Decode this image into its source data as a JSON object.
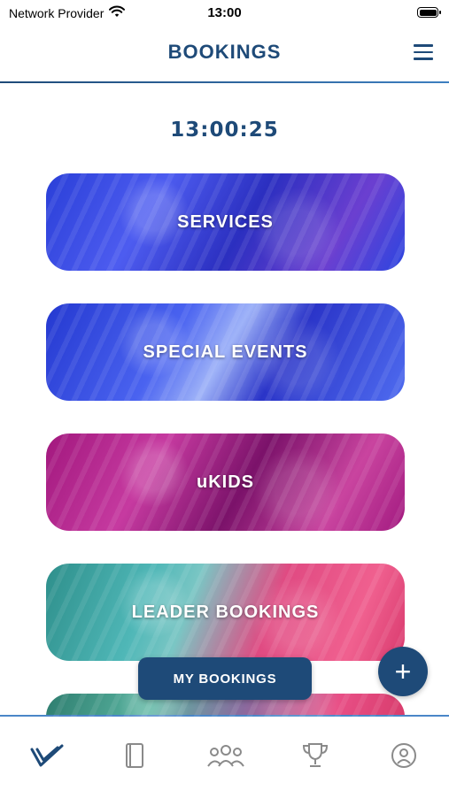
{
  "status_bar": {
    "carrier": "Network Provider",
    "time": "13:00",
    "icons": [
      "wifi-icon",
      "battery-icon"
    ]
  },
  "header": {
    "title": "BOOKINGS",
    "menu_icon": "hamburger-menu-icon"
  },
  "clock": "13:00:25",
  "tiles": [
    {
      "label": "SERVICES"
    },
    {
      "label": "SPECIAL EVENTS"
    },
    {
      "label": "uKIDS"
    },
    {
      "label": "LEADER BOOKINGS"
    }
  ],
  "my_bookings_label": "MY BOOKINGS",
  "fab": {
    "label": "+",
    "icon": "plus-icon"
  },
  "tabbar": {
    "items": [
      {
        "name": "home",
        "icon": "check-logo-icon"
      },
      {
        "name": "book",
        "icon": "book-icon"
      },
      {
        "name": "groups",
        "icon": "people-icon"
      },
      {
        "name": "achievements",
        "icon": "trophy-icon"
      },
      {
        "name": "profile",
        "icon": "person-icon"
      }
    ],
    "active_color": "#1e4a78",
    "inactive_color": "#8a8a8a"
  },
  "colors": {
    "brand": "#1e4a78",
    "accent_line": "#4a86c8"
  }
}
